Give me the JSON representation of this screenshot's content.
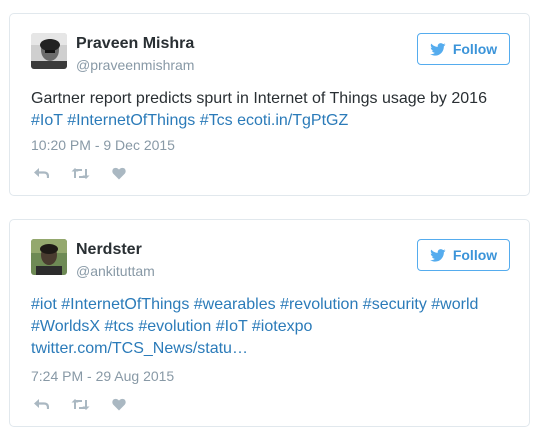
{
  "colors": {
    "link": "#2b7bb9",
    "follow_blue": "#3b94d9",
    "border": "#e1e8ed",
    "muted": "#8899a6",
    "icon": "#aab8c2",
    "text": "#292f33"
  },
  "tweets": [
    {
      "name": "Praveen Mishra",
      "handle": "@praveenmishram",
      "follow_label": "Follow",
      "text_plain": "Gartner report predicts spurt in Internet of Things usage by 2016",
      "tags": [
        "#IoT",
        "#InternetOfThings",
        "#Tcs"
      ],
      "url": "ecoti.in/TgPtGZ",
      "timestamp": "10:20 PM - 9 Dec 2015",
      "actions": [
        "reply-icon",
        "retweet-icon",
        "like-icon"
      ]
    },
    {
      "name": "Nerdster",
      "handle": "@ankituttam",
      "follow_label": "Follow",
      "tags_line1": [
        "#iot",
        "#InternetOfThings",
        "#wearables",
        "#revolution",
        "#security",
        "#world"
      ],
      "tags_line2": [
        "#WorldsX",
        "#tcs",
        "#evolution",
        "#IoT",
        "#iotexpo"
      ],
      "url": "twitter.com/TCS_News/statu…",
      "timestamp": "7:24 PM - 29 Aug 2015",
      "actions": [
        "reply-icon",
        "retweet-icon",
        "like-icon"
      ]
    }
  ]
}
